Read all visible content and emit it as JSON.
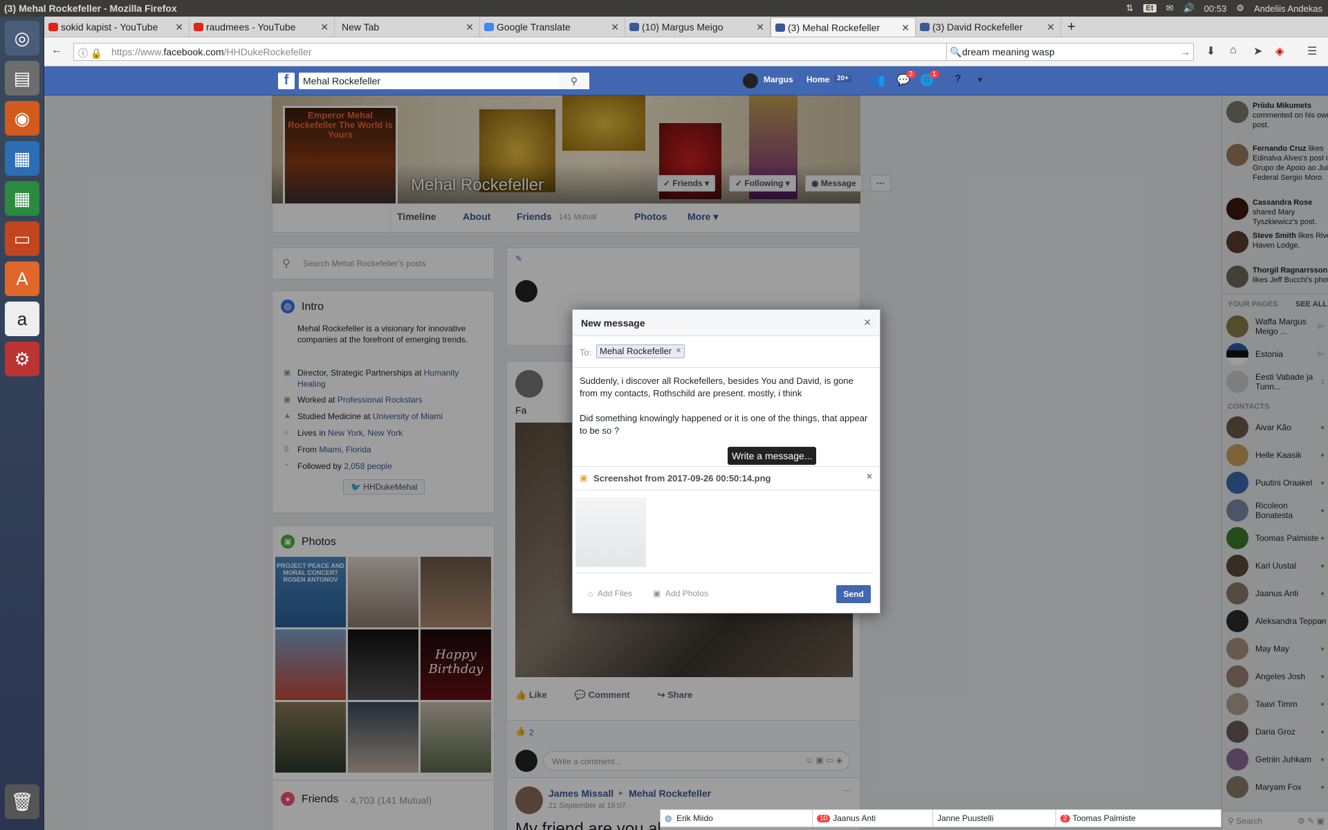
{
  "window_title": "(3) Mehal Rockefeller - Mozilla Firefox",
  "system_tray": {
    "keyboard": "Et",
    "time": "00:53",
    "user": "Andeliis Andekas"
  },
  "tabs": [
    {
      "label": "sokid kapist - YouTube",
      "color": "#e62117"
    },
    {
      "label": "raudmees - YouTube",
      "color": "#e62117"
    },
    {
      "label": "New Tab",
      "color": ""
    },
    {
      "label": "Google Translate",
      "color": "#4285f4"
    },
    {
      "label": "(10) Margus Meigo",
      "color": "#3b5998"
    },
    {
      "label": "(3) Mehal Rockefeller",
      "color": "#3b5998"
    },
    {
      "label": "(3) David Rockefeller",
      "color": "#3b5998"
    }
  ],
  "url": {
    "prefix": "https://www.",
    "domain": "facebook.com",
    "path": "/HHDukeRockefeller"
  },
  "browser_search": "dream meaning wasp",
  "fb": {
    "search_value": "Mehal Rockefeller",
    "user": "Margus",
    "home": "Home",
    "home_count": "20+",
    "msg_badge": "2",
    "notif_badge": "1"
  },
  "profile": {
    "pic_text": "Emperor Mehal Rockefeller The World is Yours",
    "name": "Mehal Rockefeller",
    "buttons": {
      "friends": "✓ Friends ▾",
      "following": "✓ Following ▾",
      "message": "Message",
      "more": "···"
    },
    "tabs": {
      "timeline": "Timeline",
      "about": "About",
      "friends": "Friends",
      "friends_mutual": "141 Mutual",
      "photos": "Photos",
      "more": "More ▾"
    }
  },
  "search_posts_placeholder": "Search Mehal Rockefeller's posts",
  "intro": {
    "title": "Intro",
    "bio": "Mehal Rockefeller is a visionary for innovative companies at the forefront of emerging trends.",
    "rows": [
      {
        "pre": "Director, Strategic Partnerships at ",
        "link": "Humanity Healing"
      },
      {
        "pre": "Worked at ",
        "link": "Professional Rockstars"
      },
      {
        "pre": "Studied Medicine at ",
        "link": "University of Miami"
      },
      {
        "pre": "Lives in ",
        "link": "New York, New York"
      },
      {
        "pre": "From ",
        "link": "Miami, Florida"
      },
      {
        "pre": "Followed by ",
        "link": "2,058 people"
      }
    ],
    "twitter": "HHDukeMehal"
  },
  "photos": {
    "title": "Photos",
    "tiles": [
      "PROJECT PEACE AND MORAL CONCERT ROSEN ANTONOV",
      "",
      "",
      "",
      "",
      "Happy Birthday",
      "",
      "",
      ""
    ]
  },
  "friends_card": {
    "title": "Friends",
    "count": "· 4,703 (141 Mutual)"
  },
  "post": {
    "prefix": "Fa",
    "like": "Like",
    "comment": "Comment",
    "share": "Share",
    "likes_count": "2",
    "comment_placeholder": "Write a comment..."
  },
  "post2": {
    "author": "James Missall",
    "target": "Mehal Rockefeller",
    "time": "21 September at 16:07 · ",
    "text_start": "My friend are you al"
  },
  "modal": {
    "title": "New message",
    "to_label": "To:",
    "recipient": "Mehal Rockefeller",
    "text_line1": "Suddenly, i discover all Rockefellers, besides You and David, is gone from my contacts,  Rothschild are present. mostly, i think",
    "text_line2": "Did  something knowingly happened or it is one of the things, that appear to be so ?",
    "tooltip": "Write a message...",
    "attachment": "Screenshot from 2017-09-26 00:50:14.png",
    "add_files": "Add Files",
    "add_photos": "Add Photos",
    "send": "Send"
  },
  "activity": [
    {
      "name": "Priidu Mikumets",
      "text": " commented on his own post."
    },
    {
      "name": "Fernando Cruz",
      "text": " likes Edinalva Alves's post in Grupo de Apoio ao Juiz Federal Sergio Moro."
    },
    {
      "name": "Cassandra Rose",
      "text": " shared Mary Tyszkiewicz's post."
    },
    {
      "name": "Steve Smith",
      "text": " likes River Haven Lodge."
    },
    {
      "name": "Thorgil Ragnarrsson",
      "text": " likes Jeff Bucchi's photo."
    }
  ],
  "your_pages": {
    "title": "YOUR PAGES",
    "see_all": "SEE ALL",
    "items": [
      {
        "name": "Waffa Margus Meigo ...",
        "count": "9+"
      },
      {
        "name": "Estonia",
        "count": "9+"
      },
      {
        "name": "Eesti Vabade ja Tunn...",
        "count": "1"
      }
    ]
  },
  "contacts": {
    "title": "CONTACTS",
    "items": [
      "Aivar Kão",
      "Helle Kaasik",
      "Puutini Oraakel",
      "Ricoleon Bonatesta",
      "Toomas Palmiste",
      "Karl Uustal",
      "Jaanus Anti",
      "Aleksandra Teppan",
      "May May",
      "Angeles Josh",
      "Taavi Timm",
      "Daria Groz",
      "Getriin Juhkam",
      "Maryam Fox"
    ]
  },
  "rail_search": "Search",
  "chat_tabs": [
    {
      "name": "Erik Miido",
      "badge": ""
    },
    {
      "name": "Jaanus Anti",
      "badge": "10"
    },
    {
      "name": "Janne Puustelli",
      "badge": ""
    },
    {
      "name": "Toomas Palmiste",
      "badge": "2"
    }
  ]
}
